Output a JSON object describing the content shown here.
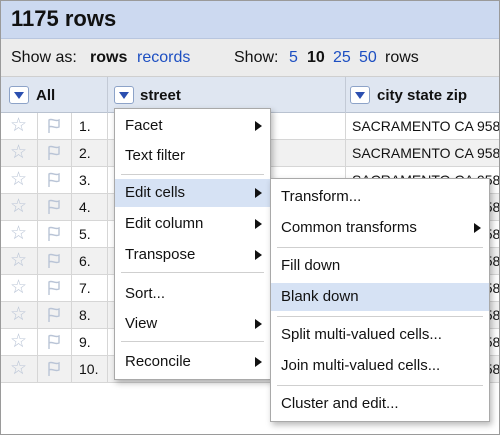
{
  "header": {
    "title": "1175 rows"
  },
  "viewbar": {
    "show_as_label": "Show as:",
    "rows_mode": "rows",
    "records_mode": "records",
    "show_label": "Show:",
    "page_sizes": [
      "5",
      "10",
      "25",
      "50"
    ],
    "selected_page_size": "10",
    "rows_suffix": "rows"
  },
  "columns": {
    "all": "All",
    "street": "street",
    "city": "city state zip"
  },
  "rows": [
    {
      "num": "1.",
      "city": "SACRAMENTO CA 958"
    },
    {
      "num": "2.",
      "city": "SACRAMENTO CA 958"
    },
    {
      "num": "3.",
      "city": "SACRAMENTO CA 958"
    },
    {
      "num": "4.",
      "city": "SACRAMENTO CA 958"
    },
    {
      "num": "5.",
      "city": "SACRAMENTO CA 958"
    },
    {
      "num": "6.",
      "city": "SACRAMENTO CA 958"
    },
    {
      "num": "7.",
      "city": "SACRAMENTO CA 958"
    },
    {
      "num": "8.",
      "city": "SACRAMENTO CA 958"
    },
    {
      "num": "9.",
      "city": "SACRAMENTO CA 958"
    },
    {
      "num": "10.",
      "city": "SACRAMENTO CA 958"
    }
  ],
  "column_menu": {
    "facet": "Facet",
    "text_filter": "Text filter",
    "edit_cells": "Edit cells",
    "edit_column": "Edit column",
    "transpose": "Transpose",
    "sort": "Sort...",
    "view": "View",
    "reconcile": "Reconcile"
  },
  "edit_cells_menu": {
    "transform": "Transform...",
    "common_transforms": "Common transforms",
    "fill_down": "Fill down",
    "blank_down": "Blank down",
    "split_multi": "Split multi-valued cells...",
    "join_multi": "Join multi-valued cells...",
    "cluster_edit": "Cluster and edit..."
  },
  "colors": {
    "header_bg": "#ccd9f0",
    "link": "#1d4fc2",
    "menu_highlight": "#d6e2f4"
  }
}
